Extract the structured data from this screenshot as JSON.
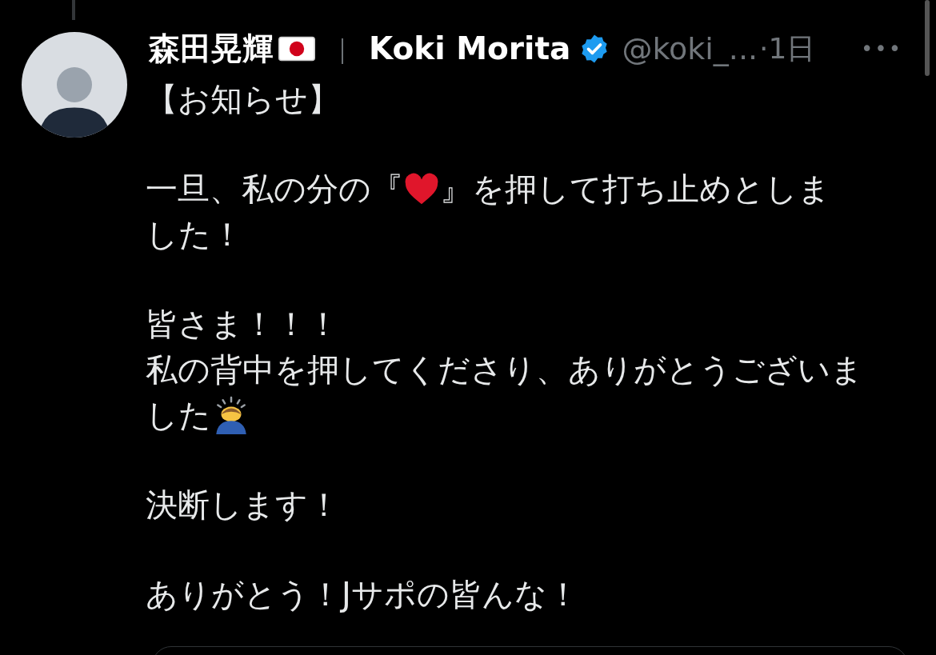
{
  "post": {
    "display_name": "森田晃輝",
    "separator": "｜",
    "secondary_name": "Koki Morita",
    "handle": "@koki_...",
    "time": "·1日",
    "more": "•••",
    "paragraphs": [
      {
        "lines": [
          {
            "segments": [
              {
                "kind": "text",
                "text": "【お知らせ】"
              }
            ]
          }
        ]
      },
      {
        "lines": [
          {
            "segments": [
              {
                "kind": "text",
                "text": "一旦、私の分の『"
              },
              {
                "kind": "heart"
              },
              {
                "kind": "text",
                "text": "』を押して打ち止めとしま"
              }
            ]
          },
          {
            "segments": [
              {
                "kind": "text",
                "text": "した！"
              }
            ]
          }
        ]
      },
      {
        "lines": [
          {
            "segments": [
              {
                "kind": "text",
                "text": "皆さま！！！"
              }
            ]
          },
          {
            "segments": [
              {
                "kind": "text",
                "text": "私の背中を押してくださり、ありがとうございま"
              }
            ]
          },
          {
            "segments": [
              {
                "kind": "text",
                "text": "した"
              },
              {
                "kind": "bow"
              }
            ]
          }
        ]
      },
      {
        "lines": [
          {
            "segments": [
              {
                "kind": "text",
                "text": "決断します！"
              }
            ]
          }
        ]
      },
      {
        "lines": [
          {
            "segments": [
              {
                "kind": "text",
                "text": "ありがとう！Jサポの皆んな！"
              }
            ]
          }
        ]
      }
    ]
  }
}
